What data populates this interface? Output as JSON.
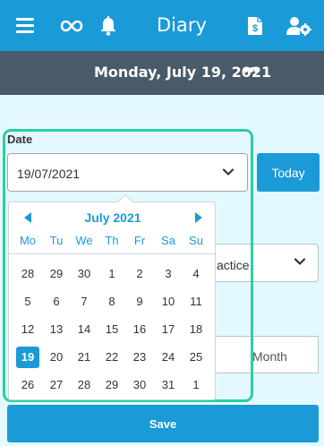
{
  "appbar": {
    "title": "Diary",
    "icons": [
      "menu-icon",
      "infinity-icon",
      "bell-icon",
      "invoice-icon",
      "user-settings-icon"
    ]
  },
  "datebar": {
    "date": "Monday, July 19, 2021",
    "more": "•••"
  },
  "date_field": {
    "label": "Date",
    "value": "19/07/2021"
  },
  "today_button": "Today",
  "background_fields": {
    "select_partial": "actice",
    "month_partial": "Month"
  },
  "calendar": {
    "month_label": "July 2021",
    "weekdays": [
      "Mo",
      "Tu",
      "We",
      "Th",
      "Fr",
      "Sa",
      "Su"
    ],
    "weeks": [
      [
        "28",
        "29",
        "30",
        "1",
        "2",
        "3",
        "4"
      ],
      [
        "5",
        "6",
        "7",
        "8",
        "9",
        "10",
        "11"
      ],
      [
        "12",
        "13",
        "14",
        "15",
        "16",
        "17",
        "18"
      ],
      [
        "19",
        "20",
        "21",
        "22",
        "23",
        "24",
        "25"
      ],
      [
        "26",
        "27",
        "28",
        "29",
        "30",
        "31",
        "1"
      ]
    ],
    "selected": "19"
  },
  "save_button": "Save",
  "colors": {
    "primary": "#1a9ad6",
    "header_dark": "#495a68",
    "content_bg": "#e4f9ff",
    "highlight": "#2ccfa3"
  }
}
